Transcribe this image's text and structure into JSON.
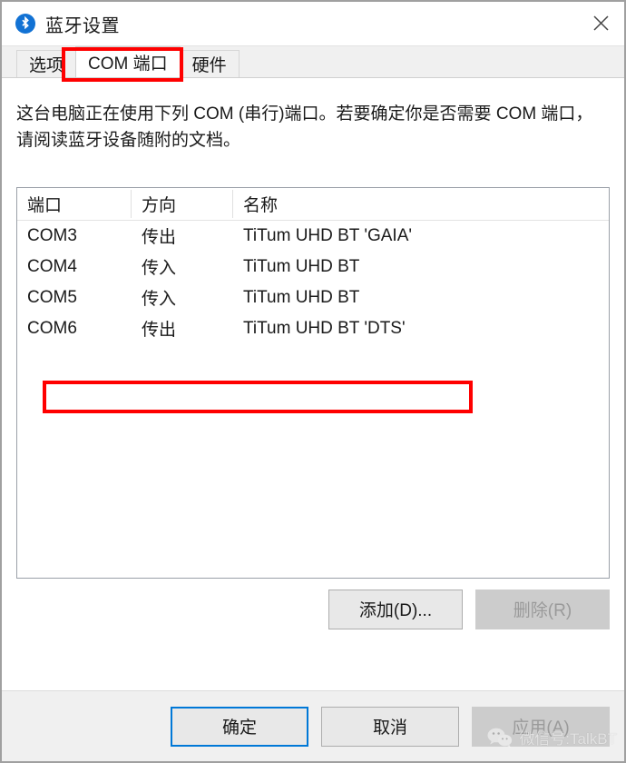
{
  "window": {
    "title": "蓝牙设置",
    "icon": "bluetooth-icon",
    "close_label": "✕"
  },
  "tabs": [
    {
      "label": "选项",
      "selected": false
    },
    {
      "label": "COM 端口",
      "selected": true
    },
    {
      "label": "硬件",
      "selected": false
    }
  ],
  "page": {
    "description": "这台电脑正在使用下列 COM (串行)端口。若要确定你是否需要 COM 端口，请阅读蓝牙设备随附的文档。"
  },
  "table": {
    "columns": [
      "端口",
      "方向",
      "名称"
    ],
    "rows": [
      {
        "port": "COM3",
        "direction": "传出",
        "name": "TiTum UHD BT 'GAIA'"
      },
      {
        "port": "COM4",
        "direction": "传入",
        "name": "TiTum UHD BT"
      },
      {
        "port": "COM5",
        "direction": "传入",
        "name": "TiTum UHD BT"
      },
      {
        "port": "COM6",
        "direction": "传出",
        "name": "TiTum UHD BT 'DTS'"
      }
    ],
    "highlighted_row_index": 3
  },
  "list_actions": {
    "add_label": "添加(D)...",
    "remove_label": "删除(R)",
    "add_enabled": true,
    "remove_enabled": false
  },
  "footer": {
    "ok_label": "确定",
    "cancel_label": "取消",
    "apply_label": "应用(A)",
    "apply_enabled": false
  },
  "watermark": {
    "text": "微信号:TalkBT",
    "logo": "wechat-logo"
  },
  "colors": {
    "accent": "#0078d7",
    "bluetooth_blue": "#1272d4",
    "annotation_red": "#ff0000",
    "dialog_bg": "#ffffff",
    "footer_bg": "#f0f0f0",
    "button_bg": "#e8e8e8",
    "disabled_bg": "#cccccc"
  }
}
